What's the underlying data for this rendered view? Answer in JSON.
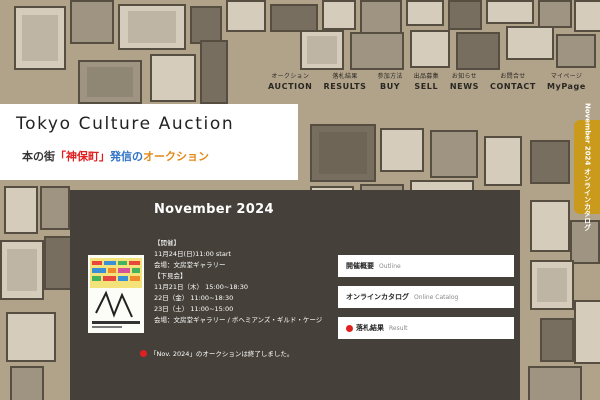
{
  "nav": [
    {
      "sub": "オークション",
      "main": "AUCTION"
    },
    {
      "sub": "落札結果",
      "main": "RESULTS"
    },
    {
      "sub": "参加方法",
      "main": "BUY"
    },
    {
      "sub": "出品募集",
      "main": "SELL"
    },
    {
      "sub": "お知らせ",
      "main": "NEWS"
    },
    {
      "sub": "お問合せ",
      "main": "CONTACT"
    },
    {
      "sub": "マイページ",
      "main": "MyPage"
    }
  ],
  "header": {
    "title": "Tokyo Culture Auction",
    "tagline": {
      "part1": "本の街",
      "part2": "「神保町」",
      "part3": "発信の",
      "part4": "オークション"
    }
  },
  "side_tab": {
    "label": "November 2024 オンラインカタログ"
  },
  "event": {
    "title": "November 2024",
    "info": [
      "【開催】",
      "11月24日(日)11:00 start",
      "会場：文房堂ギャラリー",
      "【下見会】",
      "11月21日（木） 15:00~18:30",
      "22日（金） 11:00~18:30",
      "23日（土） 11:00~15:00",
      "会場：文房堂ギャラリー / ボヘミアンズ・ギルド・ケージ"
    ],
    "note": "「Nov. 2024」のオークションは終了しました。",
    "links": [
      {
        "jp": "開催概要",
        "en": "Outline",
        "dot": false
      },
      {
        "jp": "オンラインカタログ",
        "en": "Online Catalog",
        "dot": false
      },
      {
        "jp": "落札結果",
        "en": "Result",
        "dot": true
      }
    ]
  },
  "colors": {
    "panel": "#45413a",
    "accent_gold": "#c99a1c",
    "tag_red": "#e02020",
    "tag_blue": "#2f72c7",
    "tag_orange": "#e08a18"
  }
}
